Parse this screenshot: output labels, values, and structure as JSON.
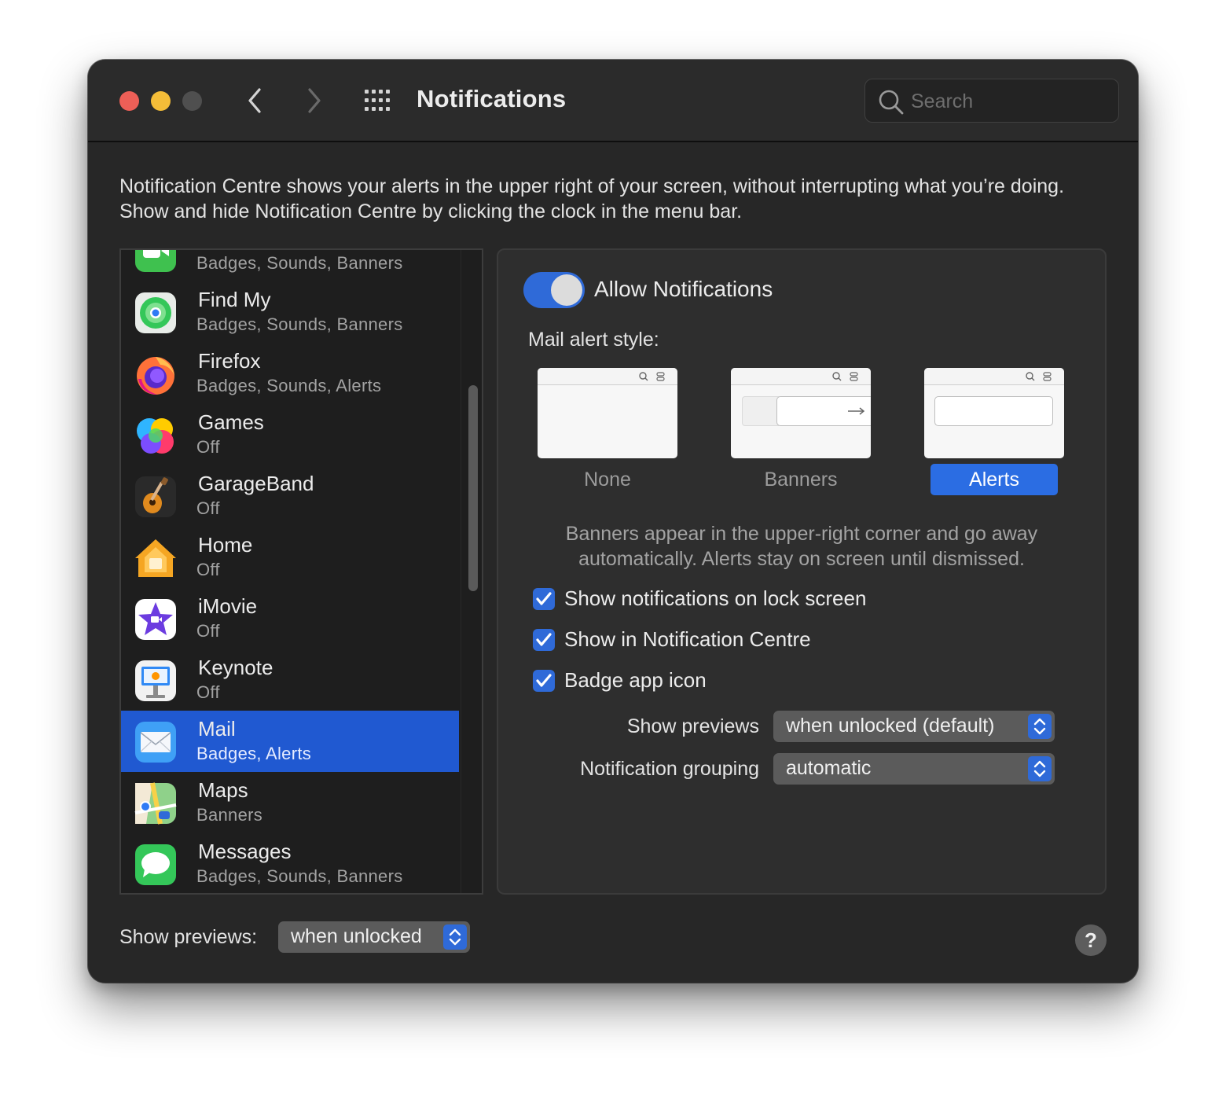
{
  "window": {
    "title": "Notifications",
    "search_placeholder": "Search"
  },
  "description": "Notification Centre shows your alerts in the upper right of your screen, without interrupting what you’re doing. Show and hide Notification Centre by clicking the clock in the menu bar.",
  "apps": [
    {
      "name": "",
      "status": "Badges, Sounds, Banners",
      "icon": "facetime-icon"
    },
    {
      "name": "Find My",
      "status": "Badges, Sounds, Banners",
      "icon": "find-my-icon"
    },
    {
      "name": "Firefox",
      "status": "Badges, Sounds, Alerts",
      "icon": "firefox-icon"
    },
    {
      "name": "Games",
      "status": "Off",
      "icon": "games-icon"
    },
    {
      "name": "GarageBand",
      "status": "Off",
      "icon": "garageband-icon"
    },
    {
      "name": "Home",
      "status": "Off",
      "icon": "home-icon"
    },
    {
      "name": "iMovie",
      "status": "Off",
      "icon": "imovie-icon"
    },
    {
      "name": "Keynote",
      "status": "Off",
      "icon": "keynote-icon"
    },
    {
      "name": "Mail",
      "status": "Badges, Alerts",
      "icon": "mail-icon",
      "selected": true
    },
    {
      "name": "Maps",
      "status": "Banners",
      "icon": "maps-icon"
    },
    {
      "name": "Messages",
      "status": "Badges, Sounds, Banners",
      "icon": "messages-icon"
    }
  ],
  "detail": {
    "allow_label": "Allow Notifications",
    "allow_enabled": true,
    "style_label": "Mail alert style:",
    "styles": [
      "None",
      "Banners",
      "Alerts"
    ],
    "selected_style": "Alerts",
    "help_text": "Banners appear in the upper-right corner and go away automatically. Alerts stay on screen until dismissed.",
    "checkboxes": [
      {
        "label": "Show notifications on lock screen",
        "checked": true
      },
      {
        "label": "Show in Notification Centre",
        "checked": true
      },
      {
        "label": "Badge app icon",
        "checked": true
      }
    ],
    "previews_label": "Show previews",
    "previews_value": "when unlocked (default)",
    "grouping_label": "Notification grouping",
    "grouping_value": "automatic"
  },
  "footer": {
    "previews_label": "Show previews:",
    "previews_value": "when unlocked",
    "help": "?"
  },
  "colors": {
    "accent": "#2f6ad8",
    "selection": "#2059d1",
    "window_bg": "#272727"
  }
}
